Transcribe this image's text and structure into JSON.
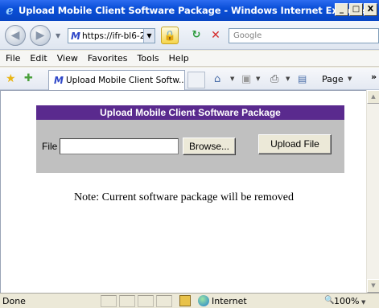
{
  "window": {
    "title": "Upload Mobile Client Software Package - Windows Internet Explorer",
    "controls": [
      "_",
      "□",
      "X"
    ]
  },
  "address_bar": {
    "url": "https://ifr-bl6-2",
    "search_placeholder": "Google"
  },
  "menu": [
    "File",
    "Edit",
    "View",
    "Favorites",
    "Tools",
    "Help"
  ],
  "tab": {
    "title": "Upload Mobile Client Softw...",
    "page_menu": "Page",
    "overflow": "»"
  },
  "page": {
    "panel_title": "Upload Mobile Client Software Package",
    "file_label": "File",
    "file_value": "",
    "browse_label": "Browse...",
    "upload_label": "Upload File",
    "note": "Note: Current software package will be removed"
  },
  "status": {
    "text": "Done",
    "zone": "Internet",
    "zoom": "100%"
  },
  "colors": {
    "panel_header": "#5a2a8e",
    "panel_body": "#c0c0c0",
    "titlebar": "#0a4fd8"
  }
}
